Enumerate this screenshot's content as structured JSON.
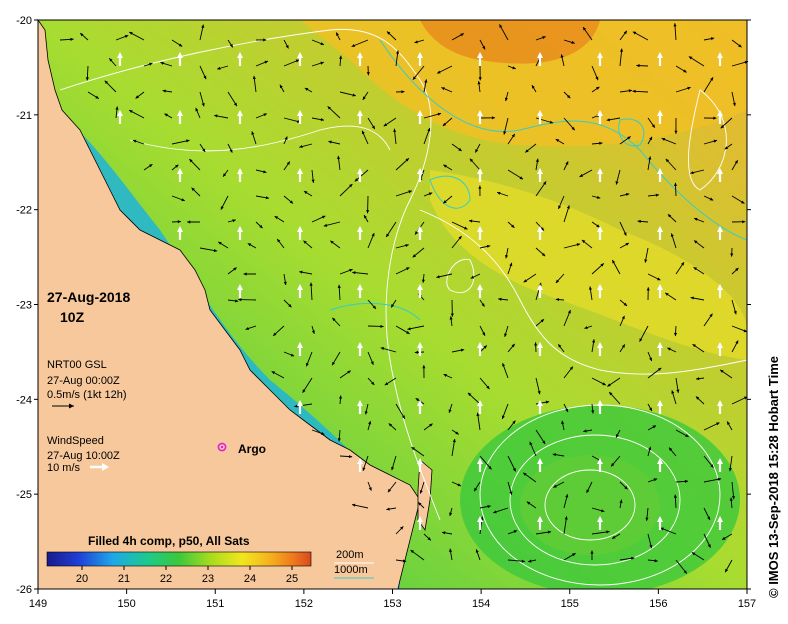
{
  "map": {
    "date_label": "27-Aug-2018",
    "time_label": "10Z",
    "currents": {
      "source": "NRT00 GSL",
      "timestamp": "27-Aug 00:00Z",
      "scale_text": "0.5m/s (1kt 12h)"
    },
    "wind": {
      "label": "WindSpeed",
      "timestamp": "27-Aug 10:00Z",
      "scale_text": "10 m/s"
    },
    "argo_label": "Argo",
    "colorbar": {
      "title": "Filled 4h comp, p50, All Sats",
      "ticks": [
        "20",
        "21",
        "22",
        "23",
        "24",
        "25"
      ],
      "colors": [
        "#1a1a8c",
        "#1f3fd6",
        "#1fa8e8",
        "#1ec98c",
        "#3cc83c",
        "#a8dc1e",
        "#f2e61e",
        "#f5b41e",
        "#f07a1e",
        "#d84a1e"
      ]
    },
    "contours": {
      "label_200m": "200m",
      "label_1000m": "1000m",
      "color_200m": "#ffffff",
      "color_1000m": "#33cccc"
    },
    "x_ticks": [
      "149",
      "150",
      "151",
      "152",
      "153",
      "154",
      "155",
      "156",
      "157"
    ],
    "y_ticks": [
      "-20",
      "-21",
      "-22",
      "-23",
      "-24",
      "-25",
      "-26"
    ],
    "credit": "© IMOS 13-Sep-2018 15:28 Hobart Time",
    "colors": {
      "land": "#f7c89b",
      "sea_warm": "#f0a82a",
      "sea_mid": "#2cc84e",
      "sea_cool": "#1c8ee0"
    }
  }
}
